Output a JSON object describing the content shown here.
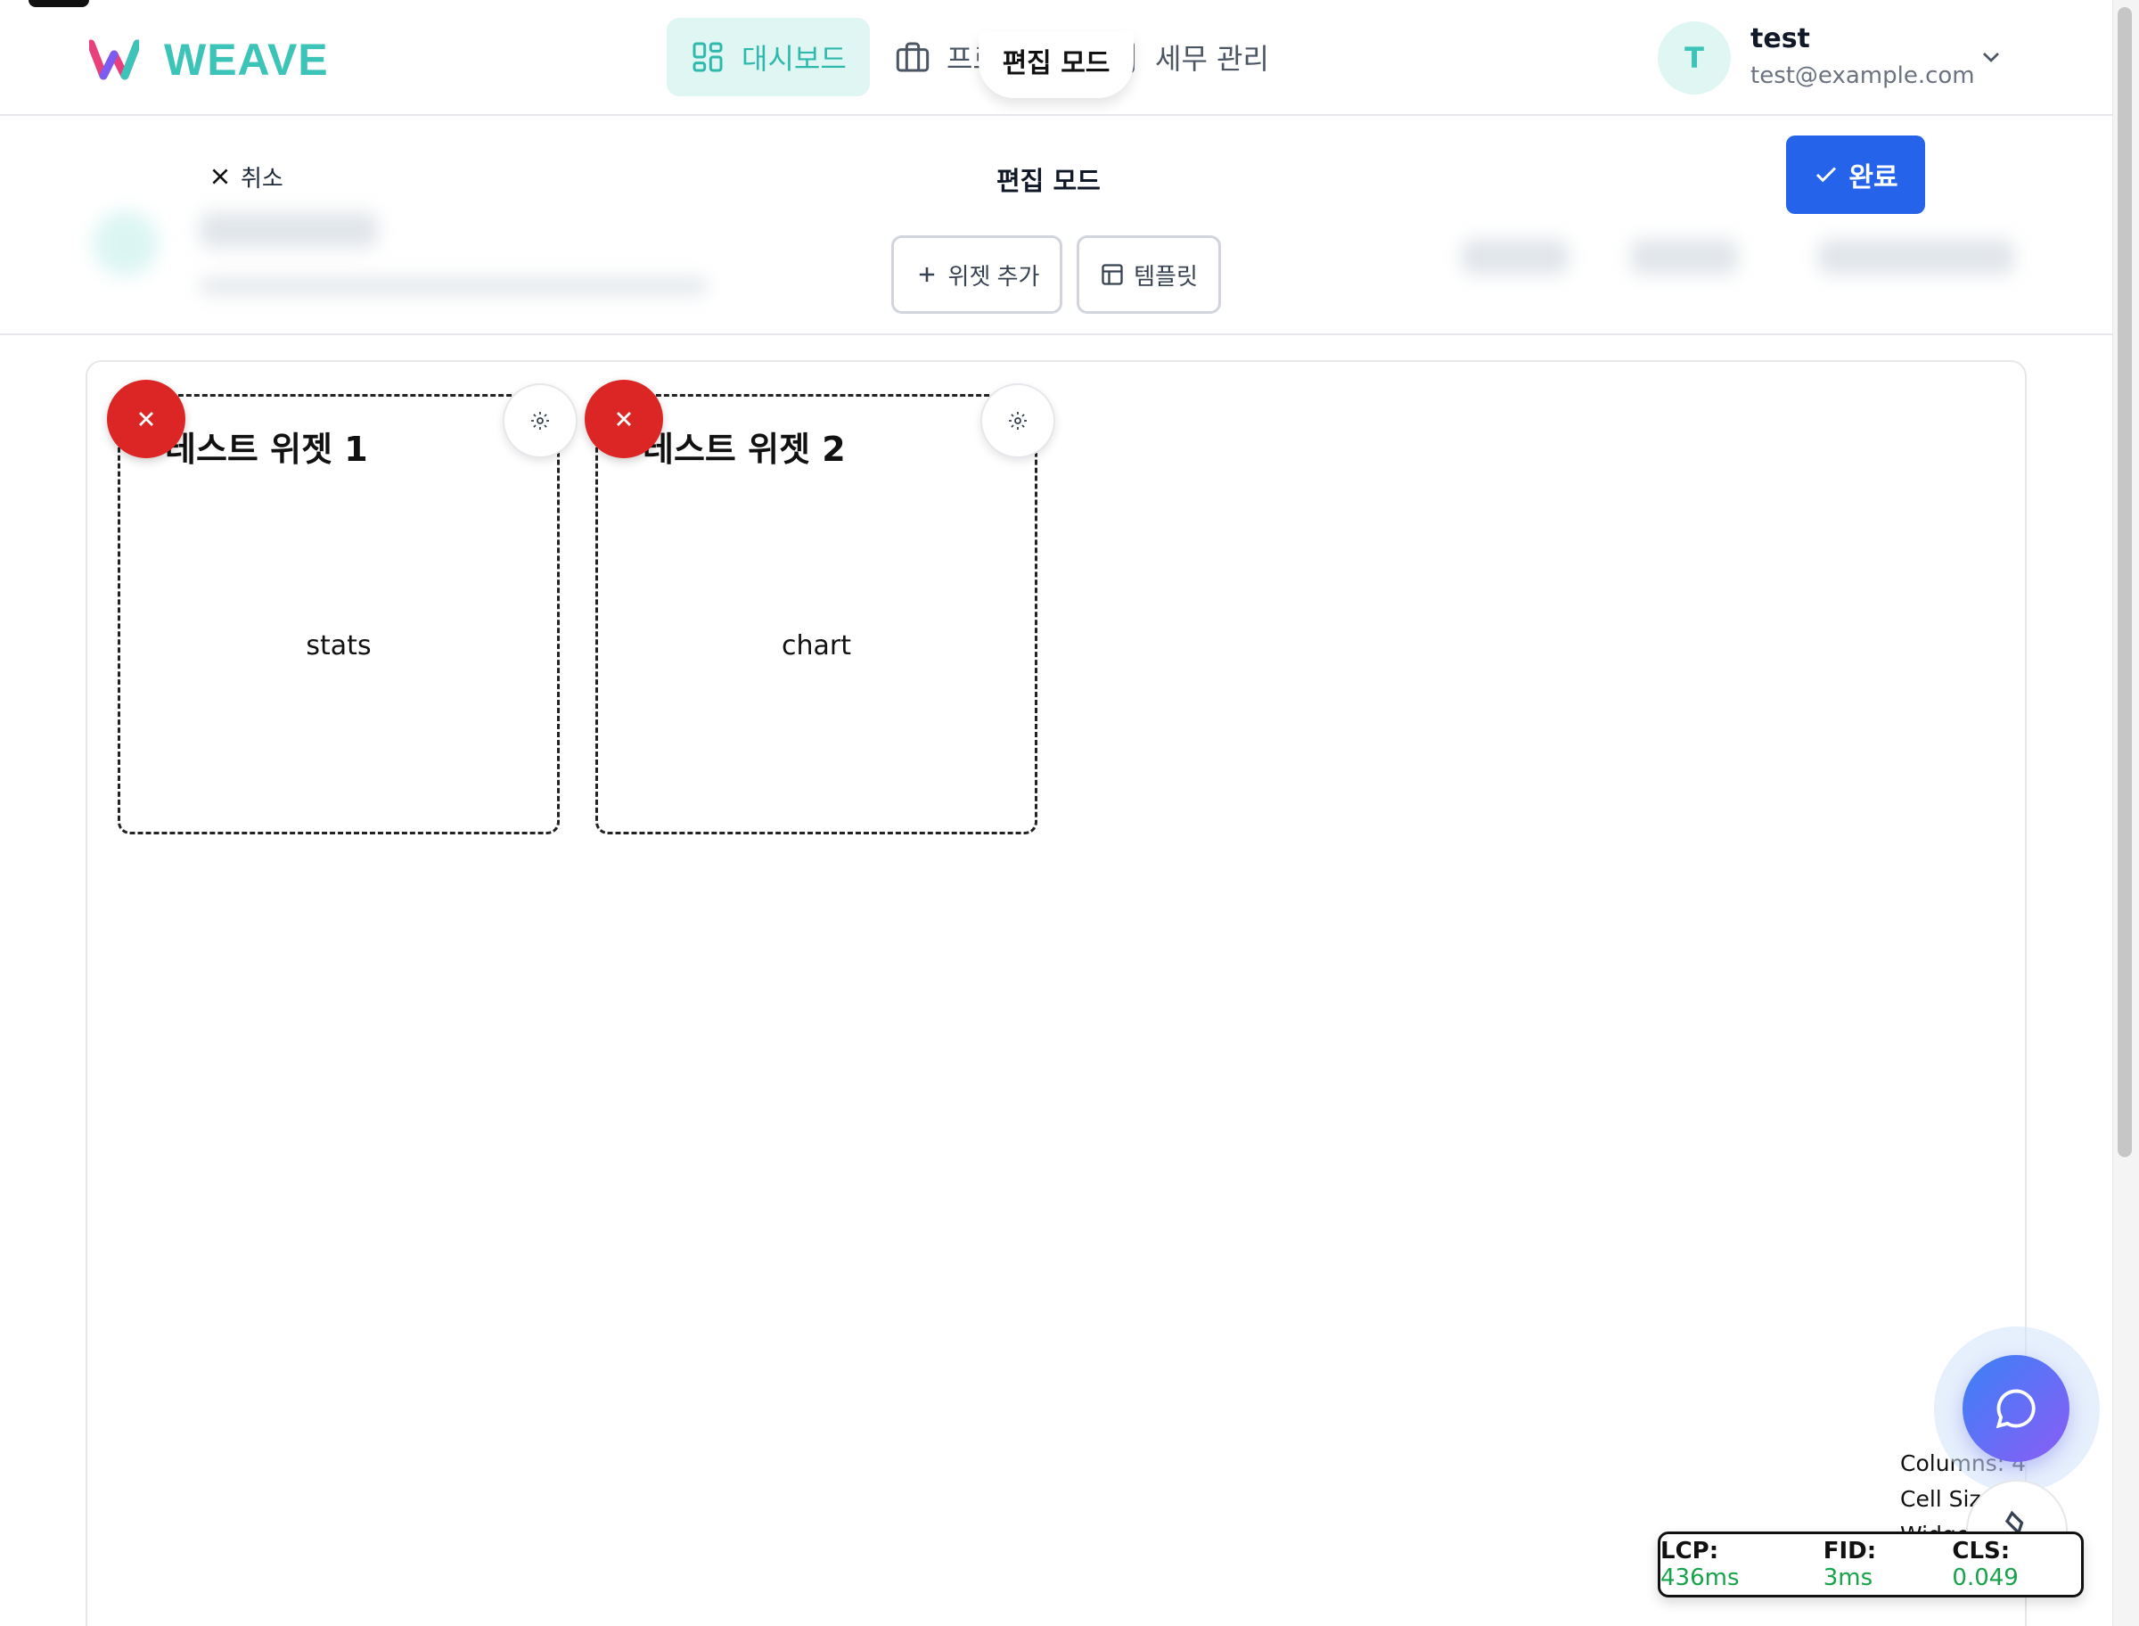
{
  "app": {
    "brand": "WEAVE"
  },
  "nav": {
    "items": [
      {
        "label": "대시보드",
        "icon": "grid-icon",
        "active": true
      },
      {
        "label": "프로젝트",
        "icon": "briefcase-icon",
        "active": false
      },
      {
        "label": "세무 관리",
        "icon": "calculator-icon",
        "active": false
      }
    ],
    "tooltip": "편집 모드"
  },
  "user": {
    "initial": "T",
    "name": "test",
    "email": "test@example.com"
  },
  "edit_bar": {
    "cancel_label": "취소",
    "title": "편집 모드",
    "done_label": "완료",
    "add_widget_label": "위젯 추가",
    "template_label": "템플릿"
  },
  "widgets": [
    {
      "title": "테스트 위젯 1",
      "type": "stats"
    },
    {
      "title": "테스트 위젯 2",
      "type": "chart"
    }
  ],
  "grid_info": {
    "columns": "Columns: 4",
    "cell_size": "Cell Size: x",
    "widgets": "Widgets"
  },
  "metrics": {
    "lcp_label": "LCP:",
    "lcp_value": "436ms",
    "fid_label": "FID:",
    "fid_value": "3ms",
    "cls_label": "CLS:",
    "cls_value": "0.049"
  },
  "colors": {
    "brand": "#3cc4b8",
    "primary": "#2563eb",
    "danger": "#dc2626",
    "metric_good": "#16a34a"
  }
}
